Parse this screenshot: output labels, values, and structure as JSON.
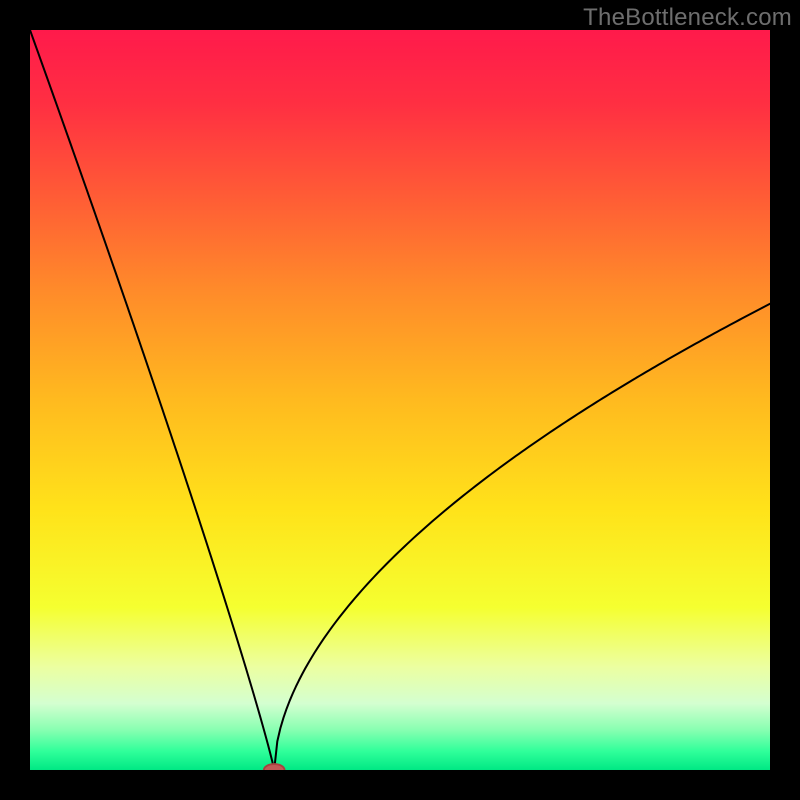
{
  "watermark": "TheBottleneck.com",
  "colors": {
    "background": "#000000",
    "watermark": "#6e6e6e",
    "curve": "#000000",
    "marker_fill": "#c05a56",
    "marker_stroke": "#a8423f",
    "gradient_stops": [
      {
        "offset": 0.0,
        "color": "#ff1a4b"
      },
      {
        "offset": 0.1,
        "color": "#ff2f42"
      },
      {
        "offset": 0.22,
        "color": "#ff5a36"
      },
      {
        "offset": 0.35,
        "color": "#ff8a2a"
      },
      {
        "offset": 0.5,
        "color": "#ffba1f"
      },
      {
        "offset": 0.65,
        "color": "#ffe31a"
      },
      {
        "offset": 0.78,
        "color": "#f5ff30"
      },
      {
        "offset": 0.86,
        "color": "#ecffa0"
      },
      {
        "offset": 0.91,
        "color": "#d4ffd0"
      },
      {
        "offset": 0.945,
        "color": "#8affb2"
      },
      {
        "offset": 0.975,
        "color": "#2fff9a"
      },
      {
        "offset": 1.0,
        "color": "#00e884"
      }
    ]
  },
  "chart_data": {
    "type": "line",
    "title": "",
    "xlabel": "",
    "ylabel": "",
    "xlim": [
      0,
      100
    ],
    "ylim": [
      0,
      100
    ],
    "x_optimum": 33,
    "curve": {
      "description": "Bottleneck-style V curve: near-linear left descent to optimum then concave rising right branch approaching ~63% at x=100.",
      "left_start_y": 100,
      "optimum": {
        "x": 33,
        "y": 0
      },
      "right_end_y_approx": 63,
      "right_shape_exponent": 0.55
    },
    "marker": {
      "x": 33,
      "y": 0,
      "rx": 1.4,
      "ry": 0.8
    }
  }
}
